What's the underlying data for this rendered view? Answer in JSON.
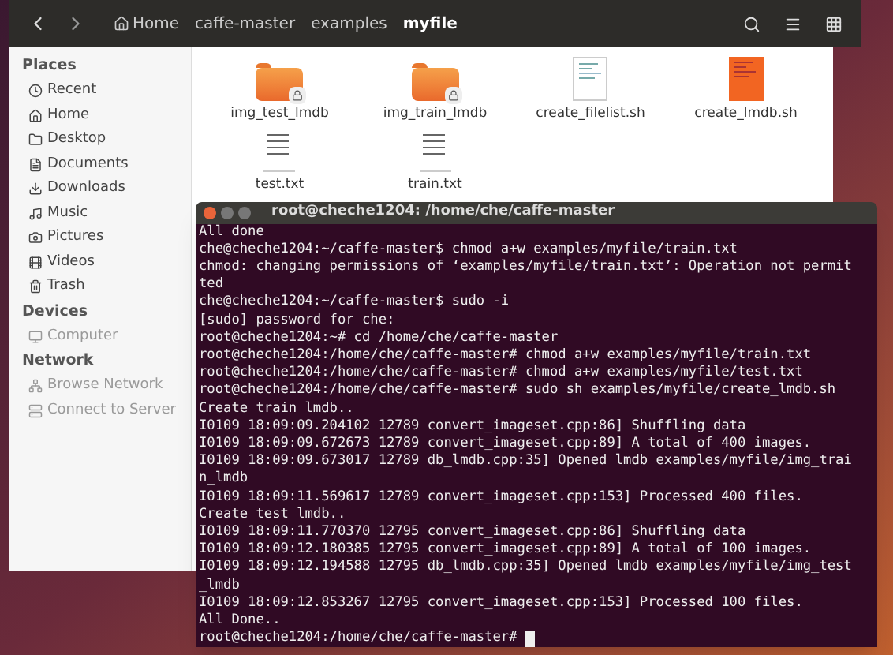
{
  "path_bar": [
    {
      "label": "Home",
      "selected": false
    },
    {
      "label": "caffe-master",
      "selected": false
    },
    {
      "label": "examples",
      "selected": false
    },
    {
      "label": "myfile",
      "selected": true
    }
  ],
  "sidebar": {
    "sections": [
      {
        "title": "Places",
        "items": [
          {
            "label": "Recent"
          },
          {
            "label": "Home"
          },
          {
            "label": "Desktop"
          },
          {
            "label": "Documents"
          },
          {
            "label": "Downloads"
          },
          {
            "label": "Music"
          },
          {
            "label": "Pictures"
          },
          {
            "label": "Videos"
          },
          {
            "label": "Trash"
          }
        ]
      },
      {
        "title": "Devices",
        "items": [
          {
            "label": "Computer"
          }
        ]
      },
      {
        "title": "Network",
        "items": [
          {
            "label": "Browse Network"
          },
          {
            "label": "Connect to Server"
          }
        ]
      }
    ]
  },
  "files": [
    {
      "name": "img_test_lmdb",
      "kind": "folder"
    },
    {
      "name": "img_train_lmdb",
      "kind": "folder"
    },
    {
      "name": "create_filelist.sh",
      "kind": "script"
    },
    {
      "name": "create_lmdb.sh",
      "kind": "orange-script"
    },
    {
      "name": "test.txt",
      "kind": "text"
    },
    {
      "name": "train.txt",
      "kind": "text"
    }
  ],
  "terminal": {
    "title": "root@cheche1204: /home/che/caffe-master",
    "lines": [
      "All done",
      "che@cheche1204:~/caffe-master$ chmod a+w examples/myfile/train.txt",
      "chmod: changing permissions of ‘examples/myfile/train.txt’: Operation not permit",
      "ted",
      "che@cheche1204:~/caffe-master$ sudo -i",
      "[sudo] password for che:",
      "root@cheche1204:~# cd /home/che/caffe-master",
      "root@cheche1204:/home/che/caffe-master# chmod a+w examples/myfile/train.txt",
      "root@cheche1204:/home/che/caffe-master# chmod a+w examples/myfile/test.txt",
      "root@cheche1204:/home/che/caffe-master# sudo sh examples/myfile/create_lmdb.sh",
      "Create train lmdb..",
      "I0109 18:09:09.204102 12789 convert_imageset.cpp:86] Shuffling data",
      "I0109 18:09:09.672673 12789 convert_imageset.cpp:89] A total of 400 images.",
      "I0109 18:09:09.673017 12789 db_lmdb.cpp:35] Opened lmdb examples/myfile/img_trai",
      "n_lmdb",
      "I0109 18:09:11.569617 12789 convert_imageset.cpp:153] Processed 400 files.",
      "Create test lmdb..",
      "I0109 18:09:11.770370 12795 convert_imageset.cpp:86] Shuffling data",
      "I0109 18:09:12.180385 12795 convert_imageset.cpp:89] A total of 100 images.",
      "I0109 18:09:12.194588 12795 db_lmdb.cpp:35] Opened lmdb examples/myfile/img_test",
      "_lmdb",
      "I0109 18:09:12.853267 12795 convert_imageset.cpp:153] Processed 100 files.",
      "All Done.."
    ],
    "prompt": "root@cheche1204:/home/che/caffe-master#"
  }
}
